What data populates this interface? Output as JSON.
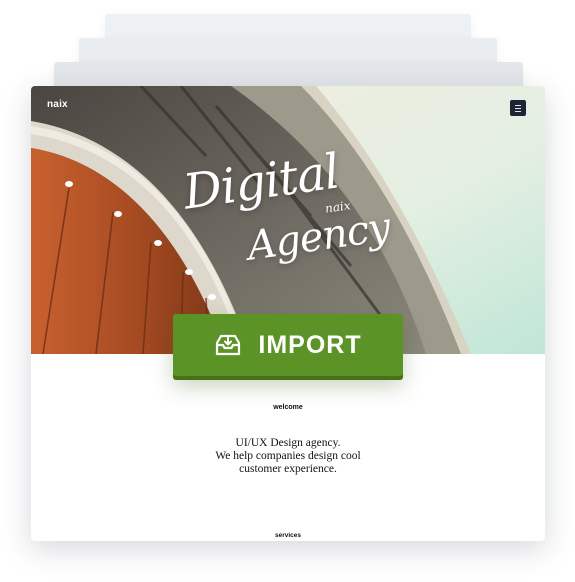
{
  "site": {
    "logo": "naix",
    "hero": {
      "line1": "Digital",
      "line2": "naix",
      "line3": "Agency"
    },
    "welcome_label": "welcome",
    "tagline": [
      "UI/UX Design agency.",
      "We help companies design cool",
      "customer experience."
    ],
    "services_label": "services"
  },
  "import_button": {
    "label": "IMPORT",
    "icon": "inbox-download-icon"
  },
  "menu_button": {
    "icon": "hamburger-menu-icon"
  },
  "colors": {
    "import_green": "#5c9327",
    "menu_navy": "#1d2436",
    "copper_panel": "#b3562c"
  }
}
